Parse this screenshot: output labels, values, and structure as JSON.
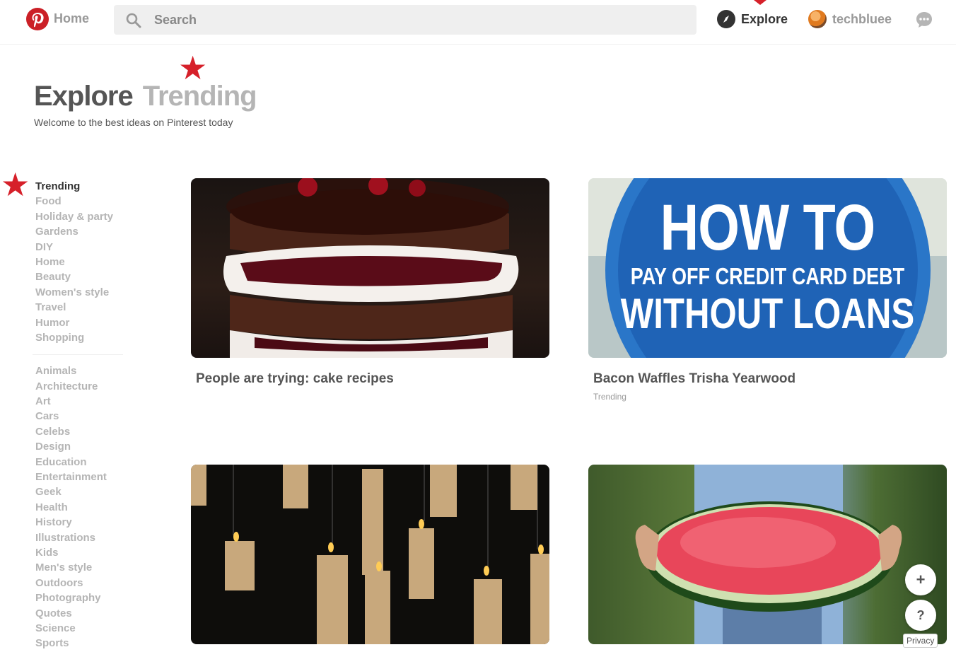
{
  "header": {
    "home_label": "Home",
    "search_placeholder": "Search",
    "explore_label": "Explore",
    "username": "techbluee"
  },
  "page": {
    "title_primary": "Explore",
    "title_secondary": "Trending",
    "subtitle": "Welcome to the best ideas on Pinterest today"
  },
  "sidebar": {
    "primary": [
      {
        "label": "Trending",
        "active": true
      },
      {
        "label": "Food"
      },
      {
        "label": "Holiday & party"
      },
      {
        "label": "Gardens"
      },
      {
        "label": "DIY"
      },
      {
        "label": "Home"
      },
      {
        "label": "Beauty"
      },
      {
        "label": "Women's style"
      },
      {
        "label": "Travel"
      },
      {
        "label": "Humor"
      },
      {
        "label": "Shopping"
      }
    ],
    "secondary": [
      {
        "label": "Animals"
      },
      {
        "label": "Architecture"
      },
      {
        "label": "Art"
      },
      {
        "label": "Cars"
      },
      {
        "label": "Celebs"
      },
      {
        "label": "Design"
      },
      {
        "label": "Education"
      },
      {
        "label": "Entertainment"
      },
      {
        "label": "Geek"
      },
      {
        "label": "Health"
      },
      {
        "label": "History"
      },
      {
        "label": "Illustrations"
      },
      {
        "label": "Kids"
      },
      {
        "label": "Men's style"
      },
      {
        "label": "Outdoors"
      },
      {
        "label": "Photography"
      },
      {
        "label": "Quotes"
      },
      {
        "label": "Science"
      },
      {
        "label": "Sports"
      }
    ]
  },
  "cards": [
    {
      "title": "People are trying: cake recipes",
      "subtitle": ""
    },
    {
      "title": "Bacon Waffles Trisha Yearwood",
      "subtitle": "Trending",
      "image_text": {
        "line1": "HOW TO",
        "line2": "PAY OFF CREDIT CARD DEBT",
        "line3": "WITHOUT LOANS"
      }
    }
  ],
  "floating": {
    "add": "+",
    "help": "?",
    "privacy": "Privacy"
  },
  "colors": {
    "brand": "#cb2027",
    "annotation_star": "#d6202a"
  }
}
